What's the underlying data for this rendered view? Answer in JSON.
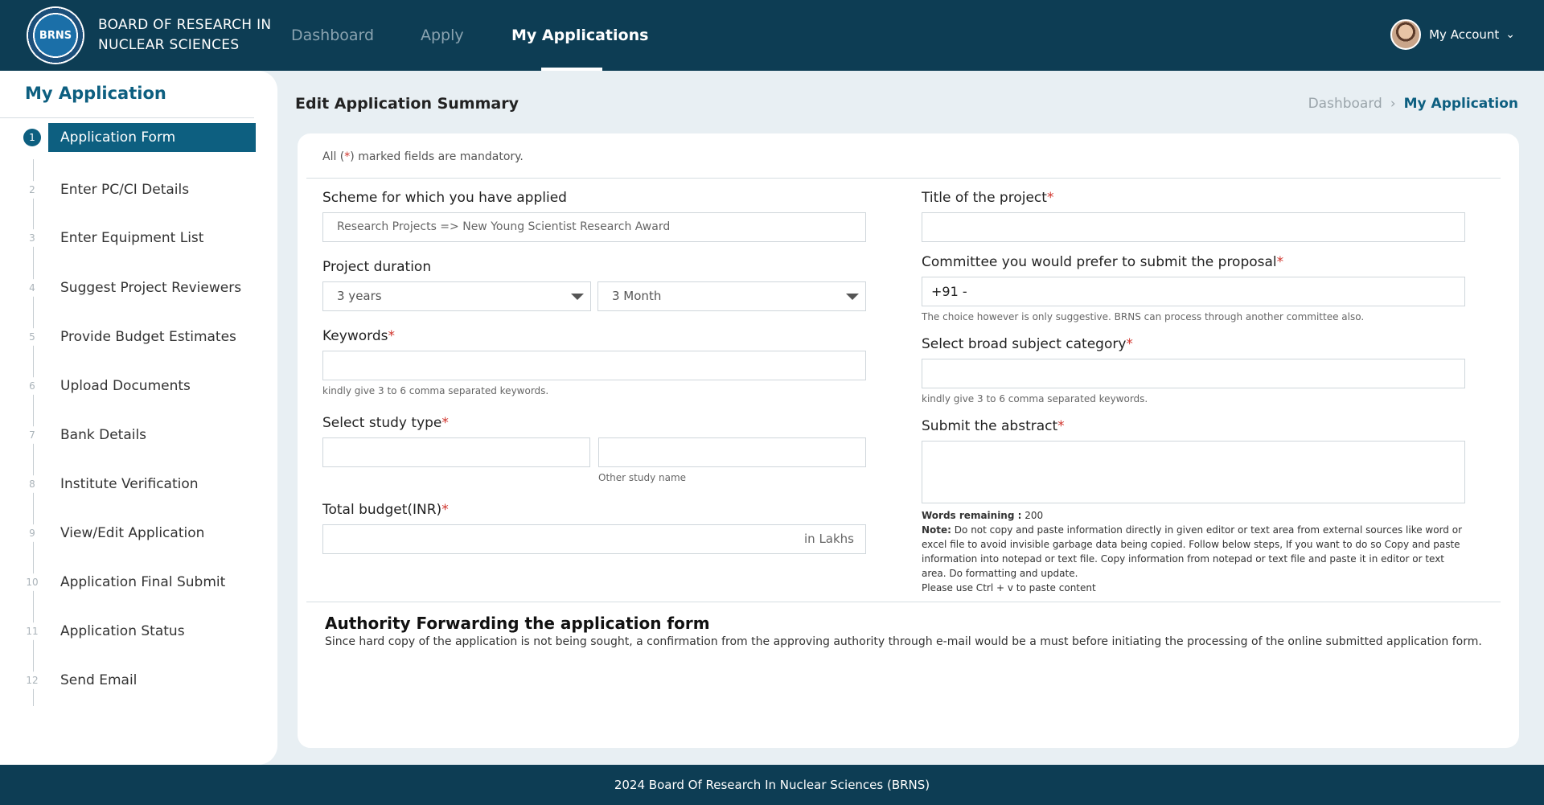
{
  "header": {
    "logo_text": "BRNS",
    "org_name_line1": "BOARD OF RESEARCH IN",
    "org_name_line2": "NUCLEAR SCIENCES",
    "nav": [
      "Dashboard",
      "Apply",
      "My Applications"
    ],
    "active_nav": "My Applications",
    "account_label": "My Account"
  },
  "sidebar": {
    "title": "My Application",
    "steps": [
      {
        "num": "1",
        "label": "Application Form",
        "active": true
      },
      {
        "num": "2",
        "label": "Enter PC/CI Details"
      },
      {
        "num": "3",
        "label": "Enter Equipment List"
      },
      {
        "num": "4",
        "label": "Suggest Project Reviewers"
      },
      {
        "num": "5",
        "label": "Provide Budget Estimates"
      },
      {
        "num": "6",
        "label": "Upload Documents"
      },
      {
        "num": "7",
        "label": "Bank Details"
      },
      {
        "num": "8",
        "label": "Institute Verification"
      },
      {
        "num": "9",
        "label": "View/Edit Application"
      },
      {
        "num": "10",
        "label": "Application Final Submit"
      },
      {
        "num": "11",
        "label": "Application Status"
      },
      {
        "num": "12",
        "label": "Send Email"
      }
    ]
  },
  "main": {
    "title": "Edit Application Summary",
    "breadcrumb": [
      "Dashboard",
      "My Application"
    ],
    "breadcrumb_sep": "›",
    "mandatory_prefix": "All (",
    "mandatory_star": "*",
    "mandatory_suffix": ") marked fields are mandatory.",
    "required_mark": "*"
  },
  "form": {
    "scheme_label": "Scheme for which you have applied",
    "scheme_value": "Research Projects => New Young Scientist Research Award",
    "duration_label": "Project duration",
    "duration_years": "3 years",
    "duration_months": "3 Month",
    "keywords_label": "Keywords",
    "keywords_hint": "kindly give 3 to 6 comma separated keywords.",
    "study_type_label": "Select study type",
    "other_study_hint": "Other study name",
    "budget_label": "Total budget(INR)",
    "budget_suffix": "in Lakhs",
    "project_title_label": "Title of the project",
    "committee_label": "Committee you would prefer to submit the proposal",
    "committee_value": "+91 -",
    "committee_hint": "The choice however is only suggestive. BRNS can process through another committee also.",
    "subject_label": "Select broad subject category",
    "subject_hint": "kindly give 3 to 6 comma separated keywords.",
    "abstract_label": "Submit the abstract",
    "words_remaining_label": "Words remaining :",
    "words_remaining_value": "200",
    "note_label": "Note:",
    "note_text": "Do not copy and paste information directly in given editor or text area from external sources like word or excel file to avoid invisible garbage data being copied. Follow below steps, If you want to do so Copy and paste information into notepad or text file. Copy information from notepad or text file and paste it in editor or text area. Do formatting and update.",
    "paste_hint": "Please use Ctrl + v to paste content"
  },
  "authority": {
    "title": "Authority Forwarding the application form",
    "text": "Since hard copy of the application is not being sought, a confirmation from the approving authority through e-mail would be a must before initiating the processing of the online submitted application form."
  },
  "footer": {
    "text": "2024 Board Of Research In Nuclear Sciences (BRNS)"
  }
}
